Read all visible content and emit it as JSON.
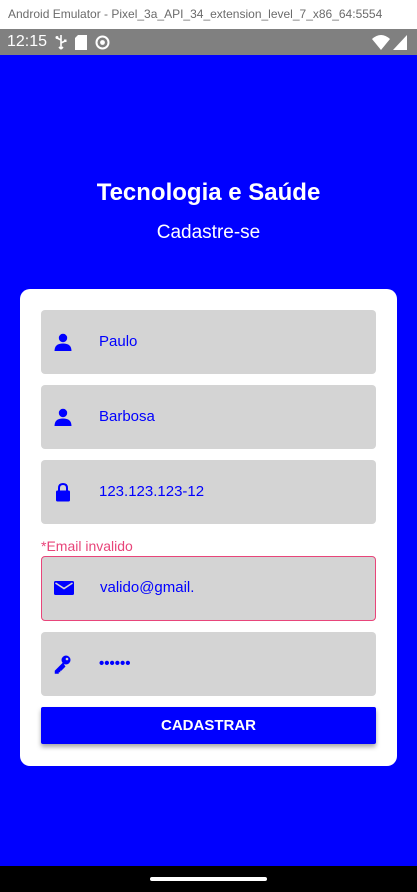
{
  "window": {
    "title": "Android Emulator - Pixel_3a_API_34_extension_level_7_x86_64:5554"
  },
  "status_bar": {
    "time": "12:15",
    "icons_left": [
      "usb-icon",
      "sd-card-icon",
      "sync-icon"
    ],
    "icons_right": [
      "wifi-icon",
      "signal-icon"
    ]
  },
  "app": {
    "background_color": "#0000ff",
    "title": "Tecnologia e Saúde",
    "subtitle": "Cadastre-se"
  },
  "form": {
    "fields": [
      {
        "icon": "person-icon",
        "value": "Paulo"
      },
      {
        "icon": "person-icon",
        "value": "Barbosa"
      },
      {
        "icon": "lock-icon",
        "value": "123.123.123-12"
      },
      {
        "icon": "email-icon",
        "value": "valido@gmail.",
        "error": "*Email invalido"
      },
      {
        "icon": "key-icon",
        "value": "••••••"
      }
    ],
    "submit_label": "CADASTRAR",
    "error_color": "#e8457a",
    "field_background": "#d4d4d4"
  }
}
